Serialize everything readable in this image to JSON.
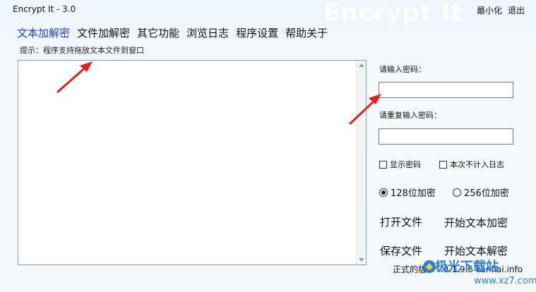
{
  "window": {
    "title": "Encrypt It - 3.0",
    "watermark": "Encrypt It",
    "minimize_label": "最小化",
    "exit_label": "退出"
  },
  "tabs": [
    {
      "label": "文本加解密",
      "active": true
    },
    {
      "label": "文件加解密",
      "active": false
    },
    {
      "label": "其它功能",
      "active": false
    },
    {
      "label": "浏览日志",
      "active": false
    },
    {
      "label": "程序设置",
      "active": false
    },
    {
      "label": "帮助关于",
      "active": false
    }
  ],
  "hint": "提示：程序支持拖放文本文件到窗口",
  "main": {
    "text_value": ""
  },
  "password": {
    "label": "请输入密码：",
    "value": "",
    "repeat_label": "请重复输入密码：",
    "repeat_value": ""
  },
  "options": {
    "show_password": {
      "label": "显示密码",
      "checked": false
    },
    "no_log": {
      "label": "本次不计入日志",
      "checked": false
    },
    "bits": [
      {
        "label": "128位加密",
        "selected": true
      },
      {
        "label": "256位加密",
        "selected": false
      }
    ]
  },
  "actions": {
    "open_file": "打开文件",
    "encrypt_text": "开始文本加密",
    "save_file": "保存文件",
    "decrypt_text": "开始文本解密"
  },
  "footer": {
    "version": "正式的版本 - 3.1.9.6 kanhai.info"
  },
  "site_watermark": {
    "name": "极光下载站",
    "url": "www.xz7.com"
  },
  "colors": {
    "active_tab": "#1a3fbf",
    "annotation_arrow": "#e02020",
    "watermark_blue": "#2d7fd6"
  }
}
